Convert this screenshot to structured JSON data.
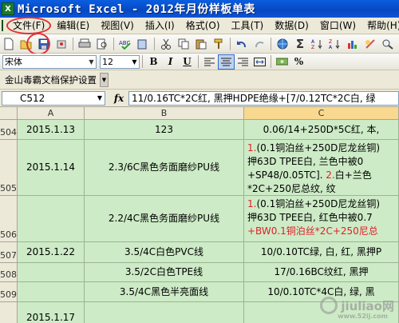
{
  "window": {
    "title": "Microsoft Excel - 2012年月份样板单表",
    "app_icon": "X"
  },
  "menu": {
    "items": [
      "文件(F)",
      "编辑(E)",
      "视图(V)",
      "插入(I)",
      "格式(O)",
      "工具(T)",
      "数据(D)",
      "窗口(W)",
      "帮助(H)"
    ]
  },
  "font_toolbar": {
    "font_name": "宋体",
    "font_size": "12",
    "bold": "B",
    "italic": "I",
    "underline": "U",
    "currency": "%"
  },
  "addin_toolbar": {
    "protect_label": "金山毒霸文档保护设置"
  },
  "formula_bar": {
    "name_box": "C512",
    "fx": "fx",
    "content": "11/0.16TC*2C红, 黑押HDPE绝缘+[7/0.12TC*2C白, 绿"
  },
  "columns": [
    "A",
    "B",
    "C"
  ],
  "rows": [
    {
      "num": "504",
      "a": "2015.1.13",
      "b": "123",
      "c": [
        {
          "t": "0.06/14+250D*5C红, 本,",
          "red": false
        }
      ]
    },
    {
      "num": "505",
      "a": "2015.1.14",
      "b": "2.3/6C黑色务面磨纱PU线",
      "c": [
        {
          "t": "1.(0.1铜泊丝+250D尼龙丝铜)",
          "red": false,
          "first_red": "1."
        },
        {
          "t": "押63D TPEE白, 兰色中被0",
          "red": false
        },
        {
          "t": "+SP48/0.05TC]. 2.白+兰色",
          "red": false,
          "mid_red": "2."
        },
        {
          "t": "*2C+250尼总纹, 纹",
          "red": false
        }
      ]
    },
    {
      "num": "506",
      "a": "",
      "b": "2.2/4C黑色务面磨纱PU线",
      "c": [
        {
          "t": "1.(0.1铜泊丝+250D尼龙丝铜)",
          "red": false,
          "first_red": "1."
        },
        {
          "t": "押63D TPEE白, 红色中被0.7",
          "red": false
        },
        {
          "t": "+BW0.1铜泊丝*2C+250尼总",
          "red": true
        }
      ]
    },
    {
      "num": "507",
      "a": "2015.1.22",
      "b": "3.5/4C白色PVC线",
      "c": [
        {
          "t": "10/0.10TC绿, 白, 红, 黑押P",
          "red": false
        }
      ]
    },
    {
      "num": "508",
      "a": "",
      "b": "3.5/2C白色TPE线",
      "c": [
        {
          "t": "17/0.16BC纹红, 黑押",
          "red": false
        }
      ]
    },
    {
      "num": "509",
      "a": "",
      "b": "3.5/4C黑色半亮面线",
      "c": [
        {
          "t": "10/0.10TC*4C白, 绿, 黑",
          "red": false
        }
      ]
    },
    {
      "num": "510",
      "a": "2015.1.17",
      "b": "",
      "c": [
        {
          "t": "",
          "red": false
        }
      ]
    }
  ],
  "watermark": {
    "text": "jiuliao网",
    "sub": "www.52ij.com"
  }
}
